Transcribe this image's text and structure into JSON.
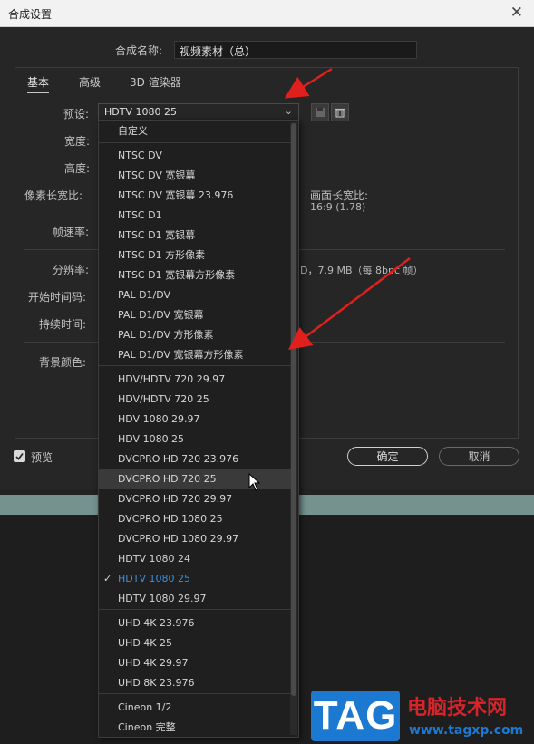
{
  "window": {
    "title": "合成设置",
    "close": "✕"
  },
  "comp_name": {
    "label": "合成名称:",
    "value": "视频素材（总）"
  },
  "tabs": [
    {
      "label": "基本"
    },
    {
      "label": "高级"
    },
    {
      "label": "3D 渲染器"
    }
  ],
  "basic": {
    "preset_label": "预设:",
    "preset_value": "HDTV 1080 25",
    "width_label": "宽度:",
    "height_label": "高度:",
    "pixel_aspect_label": "像素长宽比:",
    "frame_aspect_label": "画面长宽比:",
    "frame_aspect_value": "16:9 (1.78)",
    "frame_rate_label": "帧速率:",
    "resolution_label": "分辨率:",
    "resolution_info": "D，7.9 MB（每 8bpc 帧）",
    "start_timecode_label": "开始时间码:",
    "duration_label": "持续时间:",
    "bg_color_label": "背景颜色:"
  },
  "footer": {
    "preview_label": "预览",
    "ok_label": "确定",
    "cancel_label": "取消"
  },
  "dropdown": {
    "items": [
      "自定义",
      "NTSC DV",
      "NTSC DV 宽银幕",
      "NTSC DV 宽银幕 23.976",
      "NTSC D1",
      "NTSC D1 宽银幕",
      "NTSC D1 方形像素",
      "NTSC D1 宽银幕方形像素",
      "PAL D1/DV",
      "PAL D1/DV 宽银幕",
      "PAL D1/DV 方形像素",
      "PAL D1/DV 宽银幕方形像素",
      "HDV/HDTV 720 29.97",
      "HDV/HDTV 720 25",
      "HDV 1080 29.97",
      "HDV 1080 25",
      "DVCPRO HD 720 23.976",
      "DVCPRO HD 720 25",
      "DVCPRO HD 720 29.97",
      "DVCPRO HD 1080 25",
      "DVCPRO HD 1080 29.97",
      "HDTV 1080 24",
      "HDTV 1080 25",
      "HDTV 1080 29.97",
      "UHD 4K 23.976",
      "UHD 4K 25",
      "UHD 4K 29.97",
      "UHD 8K 23.976",
      "Cineon 1/2",
      "Cineon 完整"
    ],
    "hovered_item": "DVCPRO HD 720 25",
    "selected_item": "HDTV 1080 25",
    "check": "✓"
  },
  "watermark": {
    "logo": "TAG",
    "title": "电脑技术网",
    "url": "www.tagxp.com"
  },
  "colors": {
    "accent": "#3d8fe0",
    "arrow": "#e0201c",
    "teal": "#75928f",
    "watermark_blue": "#1c79d2",
    "watermark_red": "#d6242a"
  }
}
